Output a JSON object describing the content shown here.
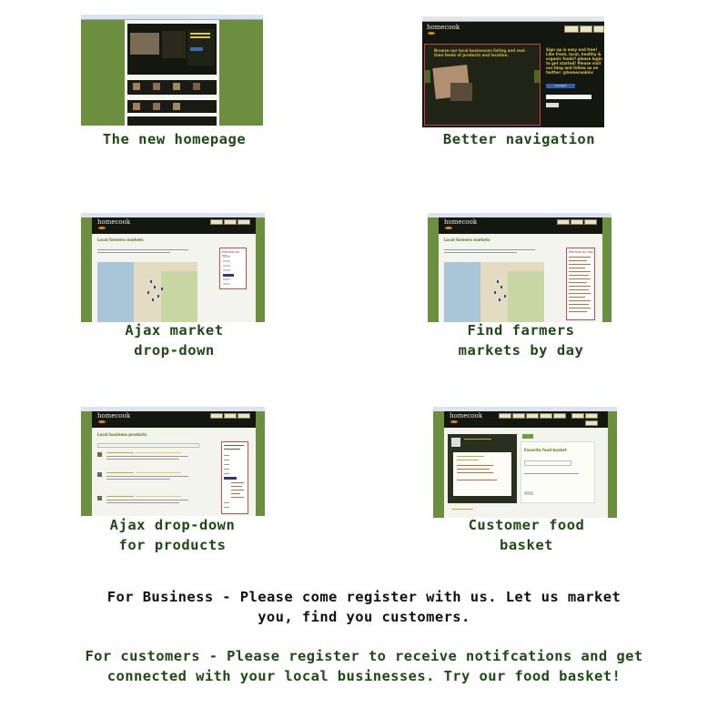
{
  "screenshots": [
    {
      "caption_lines": [
        "The new homepage"
      ]
    },
    {
      "caption_lines": [
        "Better navigation"
      ]
    },
    {
      "caption_lines": [
        "Ajax market",
        "drop-down"
      ]
    },
    {
      "caption_lines": [
        "Find farmers",
        "markets by day"
      ]
    },
    {
      "caption_lines": [
        "Ajax drop-down",
        "for products"
      ]
    },
    {
      "caption_lines": [
        "Customer food",
        "basket"
      ]
    }
  ],
  "logo_text": "homecook",
  "thumbnail_texts": {
    "nav_banner": "Browse our local businesses listing and real-time feeds of products and location.",
    "signup": "Sign up is easy and free! Like fresh, local, healthy & organic foods? please login to get started! Please visit our blog and follow us on twitter: @homecookinc",
    "signup_button": "Connect",
    "local_farmers_markets": "Local farmers markets",
    "local_business_products": "Local business products",
    "favorite_food_basket": "Favorite food basket",
    "markets_by_day_title": "Markets by day",
    "days": [
      "Sun",
      "Mon",
      "Tue",
      "Wed",
      "Thu",
      "Fri",
      "Sat"
    ]
  },
  "footer": {
    "business_line1": "For Business - Please come register with us.  Let us market",
    "business_line2": "you, find you customers.",
    "customers_line1": "For customers - Please register to receive notifcations and get",
    "customers_line2": "connected with your local businesses. Try our food basket!"
  }
}
